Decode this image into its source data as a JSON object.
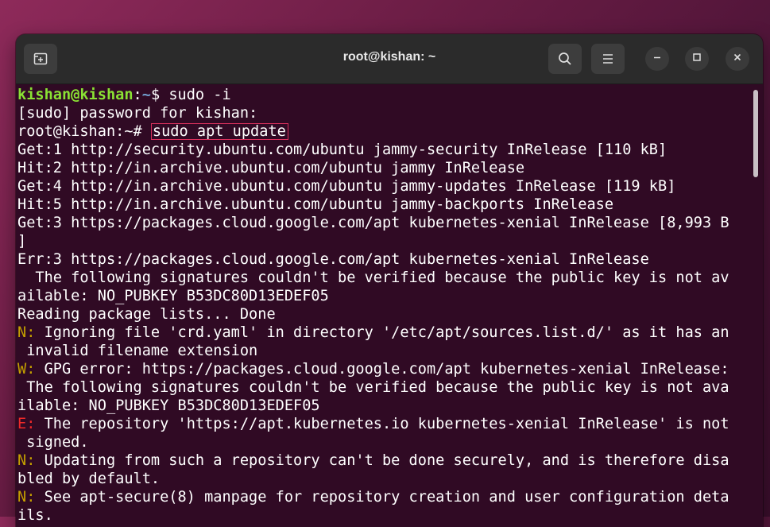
{
  "window": {
    "title": "root@kishan: ~"
  },
  "colors": {
    "terminal_bg": "#300a24",
    "prompt_user": "#8ae234",
    "prompt_path": "#729fcf",
    "notice_prefix": "#c4a000",
    "error_prefix": "#ef2929",
    "highlight_box": "#d9305c"
  },
  "icons": [
    "new-tab-icon",
    "search-icon",
    "hamburger-menu-icon",
    "minimize-icon",
    "maximize-icon",
    "close-icon"
  ],
  "terminal": {
    "prompt1": {
      "user": "kishan@kishan",
      "colon": ":",
      "path": "~",
      "dollar": "$ ",
      "command": "sudo -i"
    },
    "line2": "[sudo] password for kishan:",
    "prompt2": {
      "prefix": "root@kishan:~# ",
      "command": "sudo apt update"
    },
    "line4": "Get:1 http://security.ubuntu.com/ubuntu jammy-security InRelease [110 kB]",
    "line5": "Hit:2 http://in.archive.ubuntu.com/ubuntu jammy InRelease",
    "line6": "Get:4 http://in.archive.ubuntu.com/ubuntu jammy-updates InRelease [119 kB]",
    "line7": "Hit:5 http://in.archive.ubuntu.com/ubuntu jammy-backports InRelease",
    "line8": "Get:3 https://packages.cloud.google.com/apt kubernetes-xenial InRelease [8,993 B",
    "line9": "]",
    "line10": "Err:3 https://packages.cloud.google.com/apt kubernetes-xenial InRelease",
    "line11": "  The following signatures couldn't be verified because the public key is not av",
    "line12": "ailable: NO_PUBKEY B53DC80D13EDEF05",
    "line13": "Reading package lists... Done",
    "line14": {
      "tag": "N:",
      "text": " Ignoring file 'crd.yaml' in directory '/etc/apt/sources.list.d/' as it has an"
    },
    "line15": " invalid filename extension",
    "line16": {
      "tag": "W:",
      "text": " GPG error: https://packages.cloud.google.com/apt kubernetes-xenial InRelease:"
    },
    "line17": " The following signatures couldn't be verified because the public key is not ava",
    "line18": "ilable: NO_PUBKEY B53DC80D13EDEF05",
    "line19": {
      "tag": "E:",
      "text": " The repository 'https://apt.kubernetes.io kubernetes-xenial InRelease' is not"
    },
    "line20": " signed.",
    "line21": {
      "tag": "N:",
      "text": " Updating from such a repository can't be done securely, and is therefore disa"
    },
    "line22": "bled by default.",
    "line23": {
      "tag": "N:",
      "text": " See apt-secure(8) manpage for repository creation and user configuration deta"
    },
    "line24": "ils."
  }
}
